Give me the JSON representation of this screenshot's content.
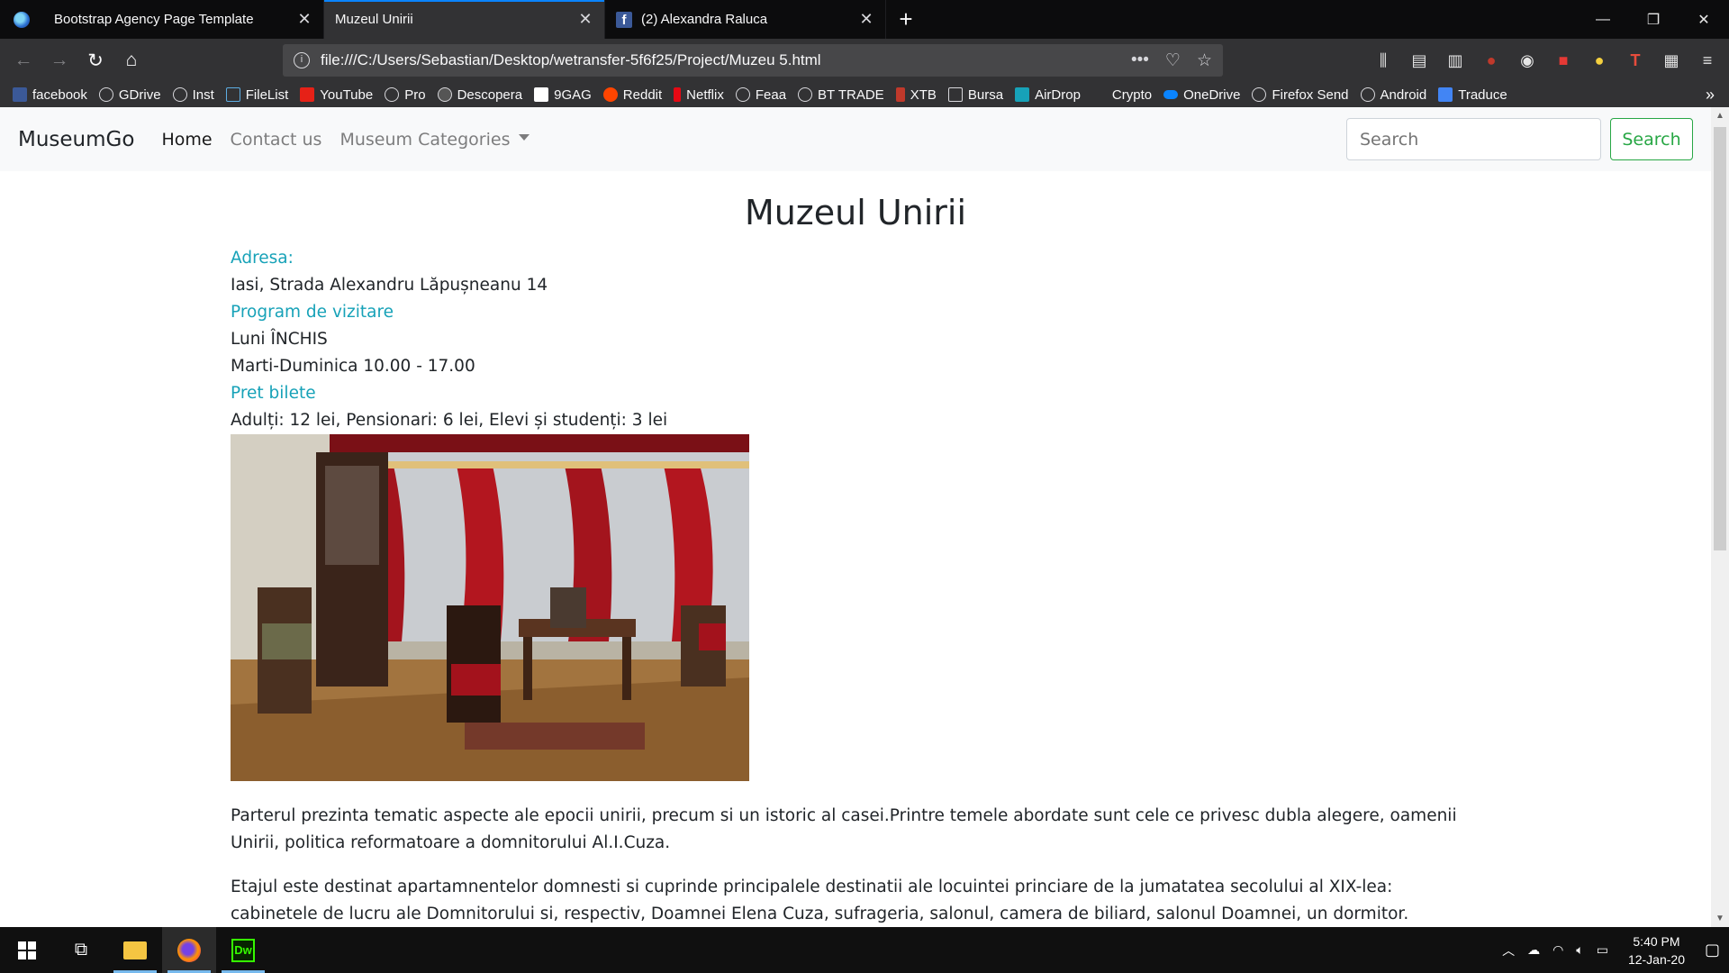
{
  "browser": {
    "tabs": [
      {
        "title": "Bootstrap Agency Page Template",
        "active": false
      },
      {
        "title": "Muzeul Unirii",
        "active": true
      },
      {
        "title": "(2) Alexandra Raluca",
        "active": false
      }
    ],
    "url": "file:///C:/Users/Sebastian/Desktop/wetransfer-5f6f25/Project/Muzeu 5.html",
    "bookmarks": [
      "facebook",
      "GDrive",
      "Inst",
      "FileList",
      "YouTube",
      "Pro",
      "Descopera",
      "9GAG",
      "Reddit",
      "Netflix",
      "Feaa",
      "BT TRADE",
      "XTB",
      "Bursa",
      "AirDrop",
      "Crypto",
      "OneDrive",
      "Firefox Send",
      "Android",
      "Traduce"
    ]
  },
  "site": {
    "brand": "MuseumGo",
    "nav": {
      "home": "Home",
      "contact": "Contact us",
      "categories": "Museum Categories"
    },
    "search": {
      "placeholder": "Search",
      "button": "Search"
    }
  },
  "museum": {
    "title": "Muzeul Unirii",
    "address_label": "Adresa:",
    "address": "Iasi, Strada Alexandru Lăpușneanu 14",
    "schedule_label": "Program de vizitare",
    "schedule_monday": "Luni ÎNCHIS",
    "schedule_rest": "Marti-Duminica 10.00 - 17.00",
    "price_label": "Pret bilete",
    "prices": "Adulți: 12 lei, Pensionari: 6 lei, Elevi și studenți: 3 lei",
    "paragraph1": "Parterul prezinta tematic aspecte ale epocii unirii, precum si un istoric al casei.Printre temele abordate sunt cele ce privesc dubla alegere, oamenii Unirii, politica reformatoare a domnitorului Al.I.Cuza.",
    "paragraph2": "Etajul este destinat apartamnentelor domnesti si cuprinde principalele destinatii ale locuintei princiare de la jumatatea secolului al XIX-lea: cabinetele de lucru ale Domnitorului si, respectiv, Doamnei Elena Cuza, sufrageria, salonul, camera de biliard, salonul Doamnei, un dormitor."
  },
  "taskbar": {
    "time": "5:40 PM",
    "date": "12-Jan-20"
  }
}
